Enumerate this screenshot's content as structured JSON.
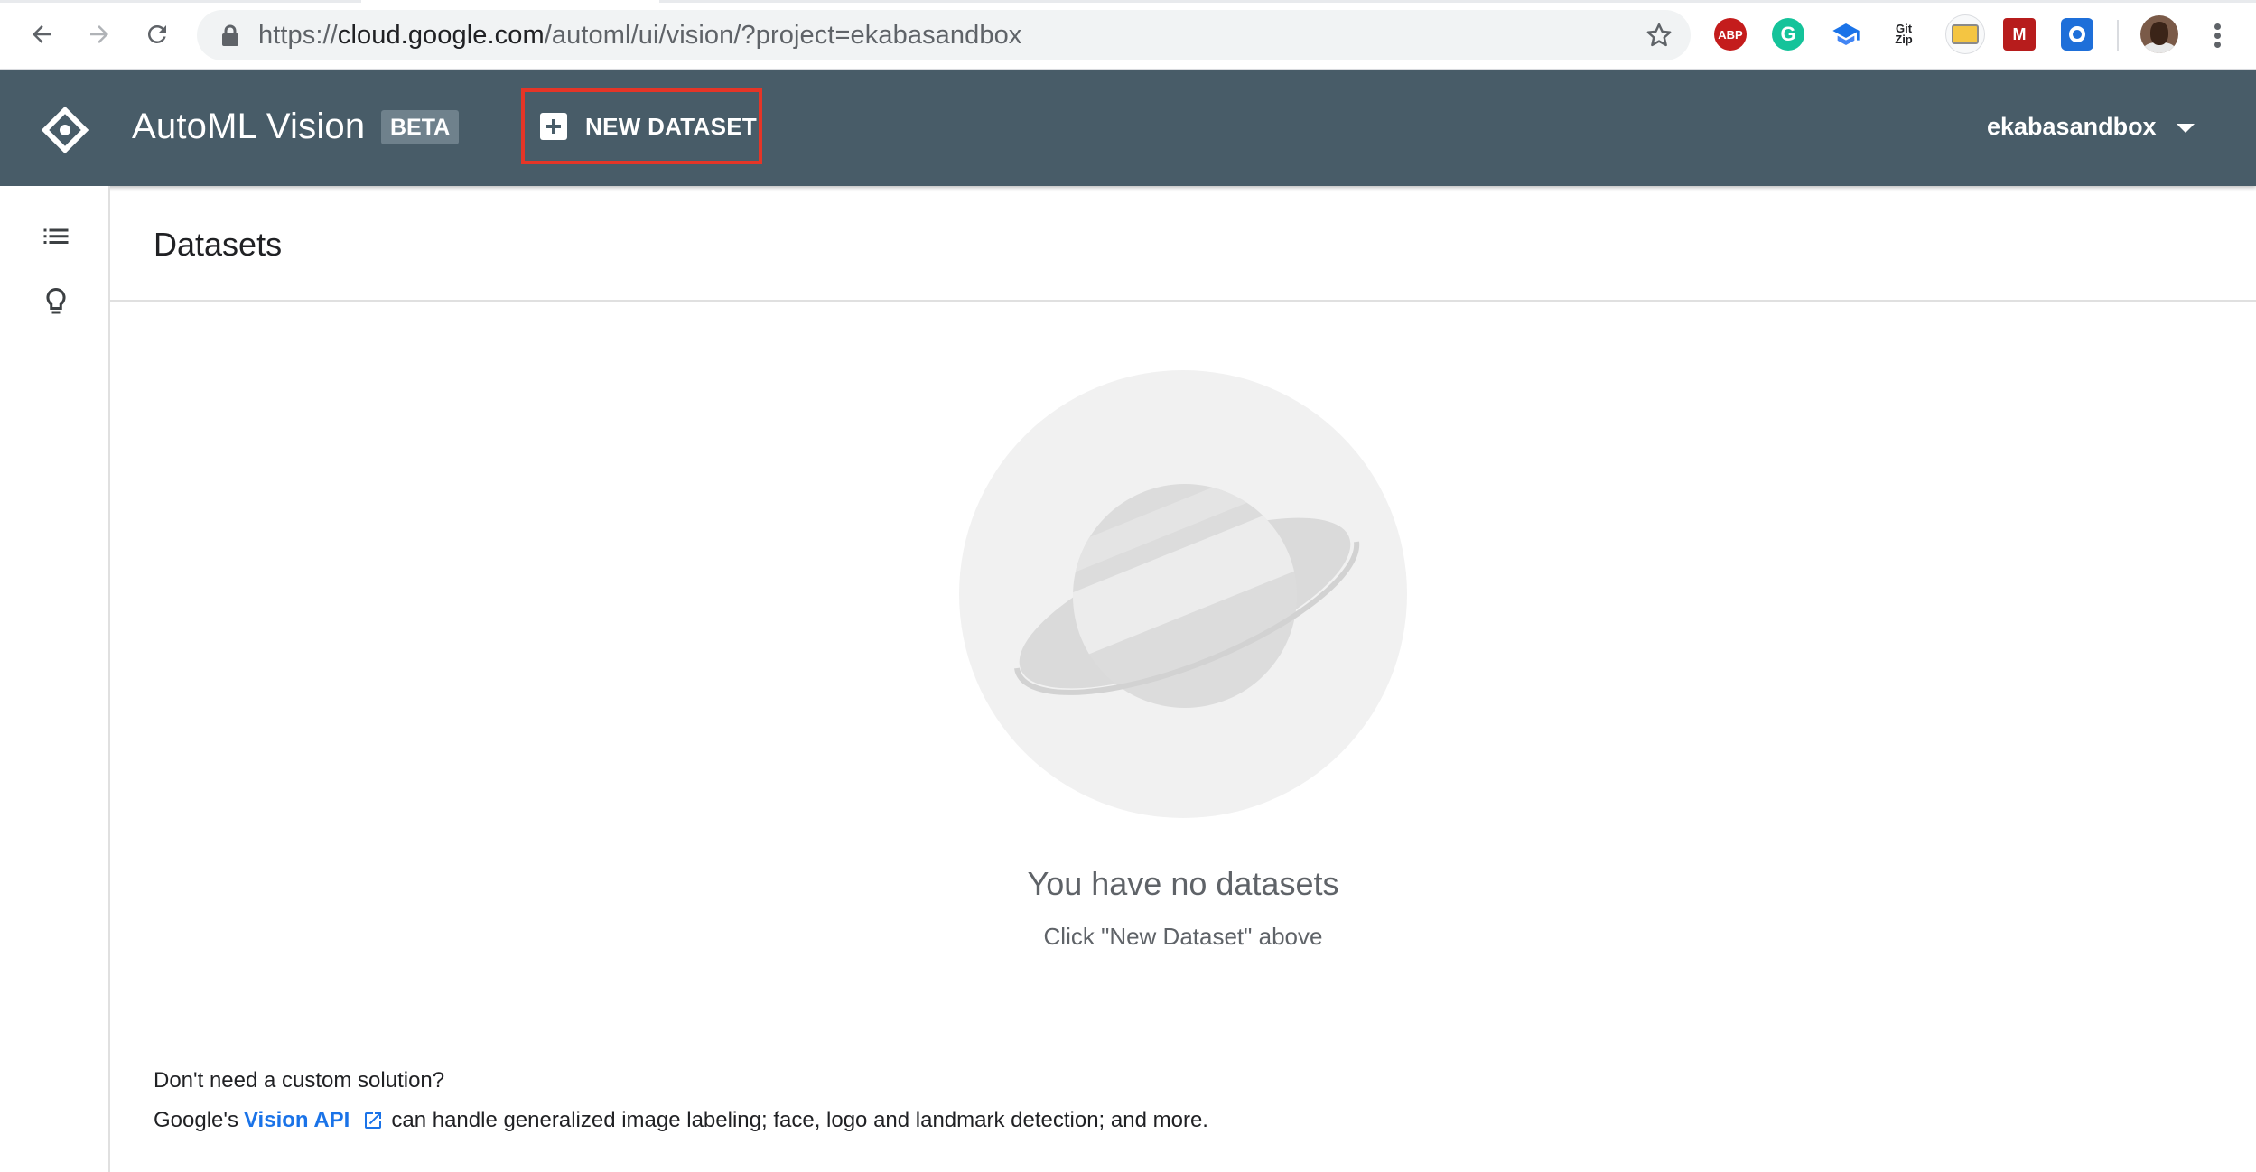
{
  "browser": {
    "url_scheme": "https://",
    "url_host": "cloud.google.com",
    "url_path": "/automl/ui/vision/?project=ekabasandbox",
    "extensions": {
      "abp_label": "ABP",
      "grammarly_label": "G",
      "gitzip_line1": "Git",
      "gitzip_line2": "Zip",
      "mendeley_label": "M"
    }
  },
  "header": {
    "app_title": "AutoML Vision",
    "badge": "BETA",
    "new_dataset_label": "NEW DATASET",
    "project_name": "ekabasandbox",
    "colors": {
      "bar": "#485c68",
      "highlight": "#e53527"
    }
  },
  "page": {
    "title": "Datasets"
  },
  "empty_state": {
    "title": "You have no datasets",
    "subtitle": "Click \"New Dataset\" above"
  },
  "footer": {
    "question": "Don't need a custom solution?",
    "prefix": "Google's",
    "link_text": "Vision API",
    "suffix": "can handle generalized image labeling; face, logo and landmark detection; and more."
  }
}
